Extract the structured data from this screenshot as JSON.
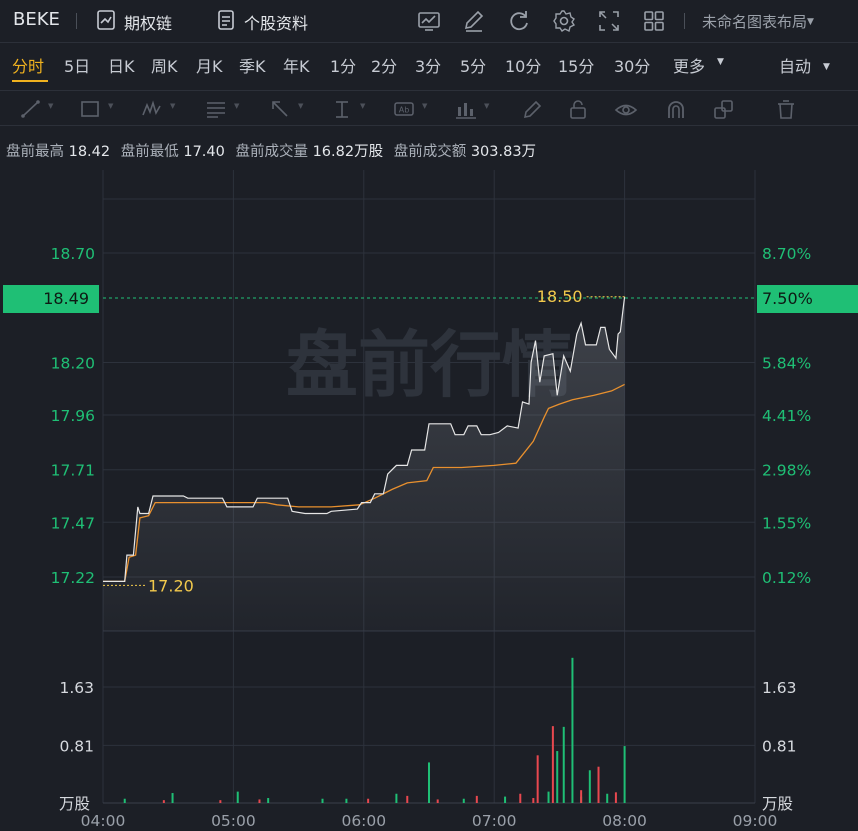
{
  "header": {
    "ticker": "BEKE",
    "option_chain": "期权链",
    "stock_info": "个股资料",
    "layout_name": "未命名图表布局",
    "icons": [
      "chart-settings-icon",
      "draw-icon",
      "refresh-icon",
      "gear-icon",
      "fullscreen-icon",
      "grid-layout-icon"
    ]
  },
  "periods": [
    {
      "label": "分时",
      "active": true
    },
    {
      "label": "5日"
    },
    {
      "label": "日K"
    },
    {
      "label": "周K"
    },
    {
      "label": "月K"
    },
    {
      "label": "季K"
    },
    {
      "label": "年K"
    },
    {
      "label": "1分"
    },
    {
      "label": "2分"
    },
    {
      "label": "3分"
    },
    {
      "label": "5分"
    },
    {
      "label": "10分"
    },
    {
      "label": "15分"
    },
    {
      "label": "30分"
    },
    {
      "label": "更多"
    }
  ],
  "auto_label": "自动",
  "tools": [
    "line-tool-icon",
    "rectangle-tool-icon",
    "pattern-tool-icon",
    "fib-tool-icon",
    "arrow-tool-icon",
    "measure-tool-icon",
    "text-tool-icon",
    "indicator-tool-icon",
    "pencil-icon",
    "lock-icon",
    "eye-icon",
    "magnet-icon",
    "layers-icon",
    "trash-icon"
  ],
  "info": {
    "high_label": "盘前最高",
    "high": "18.42",
    "low_label": "盘前最低",
    "low": "17.40",
    "vol_label": "盘前成交量",
    "vol": "16.82万股",
    "amt_label": "盘前成交额",
    "amt": "303.83万"
  },
  "watermark": "盘前行情",
  "colors": {
    "up": "#1fbf75",
    "down": "#e8484f",
    "avg": "#e8902e",
    "price": "#e6e6e6",
    "label": "#f2c94c"
  },
  "price_tag": "18.49",
  "pct_tag": "7.50%",
  "high_marker": "18.50",
  "low_marker": "17.20",
  "chart_data": {
    "type": "line",
    "price_axis": {
      "ticks": [
        "18.70",
        "18.20",
        "17.96",
        "17.71",
        "17.47",
        "17.22"
      ],
      "values": [
        18.7,
        18.2,
        17.96,
        17.71,
        17.47,
        17.22
      ],
      "pct_ticks": [
        "8.70%",
        "5.84%",
        "4.41%",
        "2.98%",
        "1.55%",
        "0.12%"
      ]
    },
    "volume_axis": {
      "ticks": [
        "1.63",
        "0.81"
      ],
      "values": [
        1.63,
        0.81
      ],
      "unit": "万股"
    },
    "x_ticks": [
      "04:00",
      "05:00",
      "06:00",
      "07:00",
      "08:00",
      "09:00"
    ],
    "x_range": [
      0,
      300
    ],
    "price_series": [
      [
        0,
        17.2
      ],
      [
        10,
        17.2
      ],
      [
        11,
        17.32
      ],
      [
        14,
        17.32
      ],
      [
        16,
        17.54
      ],
      [
        17,
        17.51
      ],
      [
        21,
        17.51
      ],
      [
        23,
        17.59
      ],
      [
        37,
        17.59
      ],
      [
        39,
        17.58
      ],
      [
        55,
        17.58
      ],
      [
        57,
        17.54
      ],
      [
        69,
        17.54
      ],
      [
        71,
        17.58
      ],
      [
        85,
        17.58
      ],
      [
        87,
        17.52
      ],
      [
        93,
        17.51
      ],
      [
        103,
        17.51
      ],
      [
        105,
        17.52
      ],
      [
        117,
        17.53
      ],
      [
        119,
        17.56
      ],
      [
        123,
        17.56
      ],
      [
        125,
        17.6
      ],
      [
        129,
        17.6
      ],
      [
        131,
        17.69
      ],
      [
        135,
        17.73
      ],
      [
        140,
        17.73
      ],
      [
        142,
        17.8
      ],
      [
        148,
        17.8
      ],
      [
        150,
        17.92
      ],
      [
        160,
        17.92
      ],
      [
        162,
        17.87
      ],
      [
        166,
        17.87
      ],
      [
        168,
        17.91
      ],
      [
        172,
        17.91
      ],
      [
        174,
        17.87
      ],
      [
        178,
        17.87
      ],
      [
        182,
        17.88
      ],
      [
        186,
        17.91
      ],
      [
        191,
        17.9
      ],
      [
        193,
        18.02
      ],
      [
        196,
        18.01
      ],
      [
        197,
        18.2
      ],
      [
        199,
        18.3
      ],
      [
        201,
        18.11
      ],
      [
        203,
        18.23
      ],
      [
        207,
        18.24
      ],
      [
        209,
        18.05
      ],
      [
        212,
        18.23
      ],
      [
        215,
        18.16
      ],
      [
        218,
        18.33
      ],
      [
        220,
        18.38
      ],
      [
        222,
        18.28
      ],
      [
        227,
        18.28
      ],
      [
        229,
        18.36
      ],
      [
        231,
        18.36
      ],
      [
        233,
        18.26
      ],
      [
        236,
        18.22
      ],
      [
        237,
        18.33
      ],
      [
        238,
        18.34
      ],
      [
        240,
        18.5
      ]
    ],
    "avg_series": [
      [
        0,
        17.2
      ],
      [
        10,
        17.2
      ],
      [
        12,
        17.31
      ],
      [
        15,
        17.32
      ],
      [
        17,
        17.49
      ],
      [
        21,
        17.5
      ],
      [
        24,
        17.56
      ],
      [
        75,
        17.56
      ],
      [
        80,
        17.55
      ],
      [
        90,
        17.54
      ],
      [
        105,
        17.54
      ],
      [
        118,
        17.55
      ],
      [
        125,
        17.58
      ],
      [
        133,
        17.62
      ],
      [
        140,
        17.65
      ],
      [
        149,
        17.66
      ],
      [
        152,
        17.72
      ],
      [
        165,
        17.72
      ],
      [
        180,
        17.73
      ],
      [
        190,
        17.74
      ],
      [
        198,
        17.84
      ],
      [
        203,
        17.95
      ],
      [
        205,
        17.99
      ],
      [
        210,
        18.01
      ],
      [
        216,
        18.03
      ],
      [
        226,
        18.05
      ],
      [
        234,
        18.07
      ],
      [
        240,
        18.1
      ]
    ],
    "volume_up": [
      [
        10,
        0.06
      ],
      [
        32,
        0.14
      ],
      [
        62,
        0.16
      ],
      [
        76,
        0.07
      ],
      [
        101,
        0.06
      ],
      [
        112,
        0.06
      ],
      [
        135,
        0.13
      ],
      [
        150,
        0.57
      ],
      [
        166,
        0.06
      ],
      [
        185,
        0.09
      ],
      [
        205,
        0.16
      ],
      [
        209,
        0.73
      ],
      [
        212,
        1.07
      ],
      [
        216,
        2.04
      ],
      [
        220,
        0.09
      ],
      [
        224,
        0.46
      ],
      [
        232,
        0.13
      ],
      [
        240,
        0.8
      ]
    ],
    "volume_down": [
      [
        28,
        0.04
      ],
      [
        54,
        0.04
      ],
      [
        72,
        0.05
      ],
      [
        122,
        0.06
      ],
      [
        140,
        0.1
      ],
      [
        154,
        0.05
      ],
      [
        172,
        0.1
      ],
      [
        192,
        0.13
      ],
      [
        198,
        0.07
      ],
      [
        200,
        0.67
      ],
      [
        207,
        1.08
      ],
      [
        220,
        0.18
      ],
      [
        228,
        0.51
      ],
      [
        236,
        0.15
      ]
    ]
  }
}
